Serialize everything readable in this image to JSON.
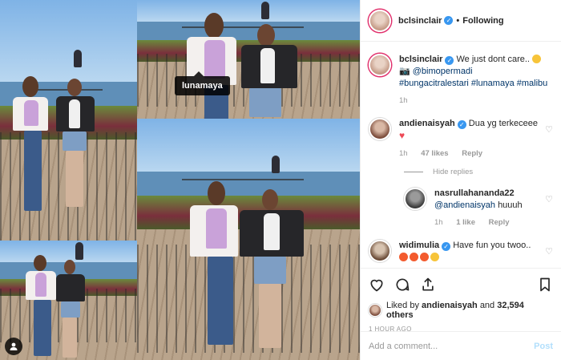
{
  "photo": {
    "tag_label": "lunamaya"
  },
  "header": {
    "username": "bclsinclair",
    "separator": "•",
    "follow_status": "Following"
  },
  "caption": {
    "username": "bclsinclair",
    "text": "We just dont care..",
    "camera_emoji": "📷",
    "mention": "@bimopermadi",
    "hashtags": "#bungacitralestari #lunamaya #malibu",
    "time": "1h"
  },
  "comments": [
    {
      "username": "andienaisyah",
      "text": "Dua yg terkeceee",
      "time": "1h",
      "likes": "47 likes",
      "reply_label": "Reply"
    }
  ],
  "hide_replies_label": "Hide replies",
  "reply": {
    "username": "nasrullahananda22",
    "mention": "@andienaisyah",
    "text": "huuuh",
    "time": "1h",
    "likes": "1 like",
    "reply_label": "Reply"
  },
  "comment3": {
    "username": "widimulia",
    "text": "Have fun you twoo.."
  },
  "likes": {
    "prefix": "Liked by",
    "user": "andienaisyah",
    "connector": "and",
    "others": "32,594 others"
  },
  "timestamp": "1 HOUR AGO",
  "add_comment": {
    "placeholder": "Add a comment...",
    "post_label": "Post"
  },
  "colors": {
    "verified": "#3897f0",
    "heart": "#ed4956",
    "post_disabled": "#b2dffc"
  }
}
